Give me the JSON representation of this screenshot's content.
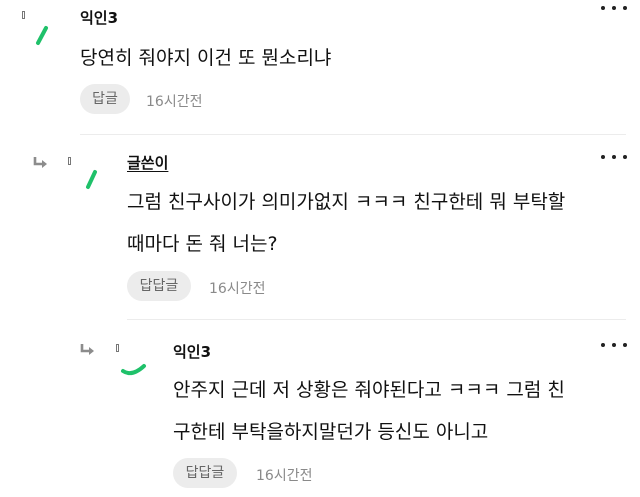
{
  "comments": [
    {
      "author": "익인3",
      "lines": [
        "당연히 줘야지 이건 또 뭔소리냐"
      ],
      "reply_label": "답글",
      "time": "16시간전"
    },
    {
      "author": "글쓴이",
      "lines": [
        "그럼 친구사이가 의미가없지 ㅋㅋㅋ 친구한테 뭐 부탁할",
        "때마다 돈 줘 너는?"
      ],
      "reply_label": "답답글",
      "time": "16시간전"
    },
    {
      "author": "익인3",
      "lines": [
        "안주지 근데 저 상황은 줘야된다고 ㅋㅋㅋ 그럼 친",
        "구한테 부탁을하지말던가 등신도 아니고"
      ],
      "reply_label": "답답글",
      "time": "16시간전"
    }
  ],
  "colors": {
    "accent_green": "#1fc16a",
    "reply_bg": "#ececec",
    "time_text": "#8a8a8a"
  },
  "icons": {
    "reply_arrow": "reply-arrow-icon",
    "more": "more-icon"
  }
}
